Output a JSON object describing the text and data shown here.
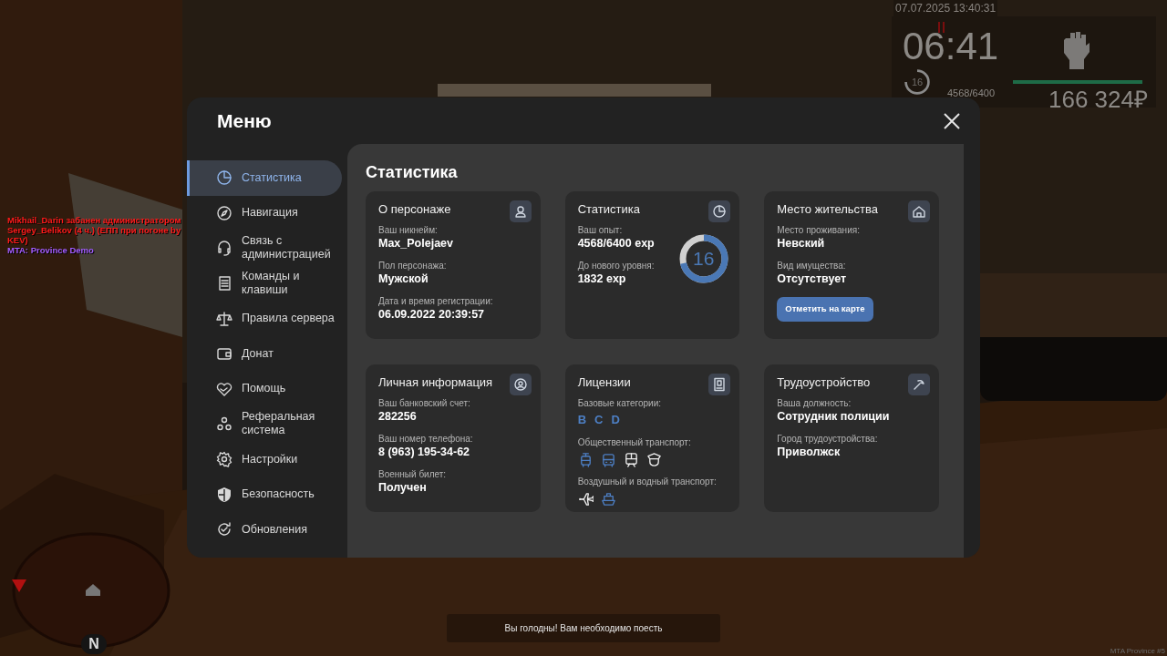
{
  "hud": {
    "datetime": "07.07.2025 13:40:31",
    "clock": "06:41",
    "level_number": "16",
    "exp": "4568/6400",
    "health": {
      "level": 1
    },
    "money": "166 324₽"
  },
  "chat": [
    {
      "text": "Mikhail_Darin забанен администратором Sergey_Belikov (4 ч.) (ЕПП при погоне by KEV)",
      "color": "#ff1a1a"
    },
    {
      "text": "MTA: Province Demo",
      "color": "#a25cff"
    }
  ],
  "minimap": {
    "compass": "N"
  },
  "menu": {
    "title": "Меню",
    "sidebar": [
      {
        "label": "Статистика",
        "selected": true
      },
      {
        "label": "Навигация",
        "selected": false
      },
      {
        "label": "Связь с администрацией",
        "selected": false
      },
      {
        "label": "Команды и клавиши",
        "selected": false
      },
      {
        "label": "Правила сервера",
        "selected": false
      },
      {
        "label": "Донат",
        "selected": false
      },
      {
        "label": "Помощь",
        "selected": false
      },
      {
        "label": "Реферальная система",
        "selected": false
      },
      {
        "label": "Настройки",
        "selected": false
      },
      {
        "label": "Безопасность",
        "selected": false
      },
      {
        "label": "Обновления",
        "selected": false
      }
    ],
    "page_title": "Статистика",
    "cards": [
      {
        "kind": "fields",
        "title": "О персонаже",
        "fields": [
          {
            "label": "Ваш никнейм:",
            "value": "Max_Polejaev"
          },
          {
            "label": "Пол персонажа:",
            "value": "Мужской"
          },
          {
            "label": "Дата и время регистрации:",
            "value": "06.09.2022 20:39:57"
          }
        ]
      },
      {
        "kind": "fields",
        "title": "Статистика",
        "fields": [
          {
            "label": "Ваш опыт:",
            "value": "4568/6400 exp"
          },
          {
            "label": "До нового уровня:",
            "value": "1832 exp"
          }
        ],
        "ring": {
          "value": "16",
          "level": 0.71
        }
      },
      {
        "kind": "fields",
        "title": "Место жительства",
        "fields": [
          {
            "label": "Место проживания:",
            "value": "Невский"
          },
          {
            "label": "Вид имущества:",
            "value": "Отсутствует"
          }
        ],
        "button": "Отметить на карте"
      },
      {
        "kind": "fields",
        "title": "Личная информация",
        "fields": [
          {
            "label": "Ваш банковский счет:",
            "value": "282256"
          },
          {
            "label": "Ваш номер телефона:",
            "value": "8 (963) 195-34-62"
          },
          {
            "label": "Военный билет:",
            "value": "Получен"
          }
        ]
      },
      {
        "kind": "licenses",
        "title": "Лицензии",
        "sections": [
          {
            "kind": "letters",
            "label": "Базовые категории:",
            "items": [
              {
                "text": "B",
                "held": true
              },
              {
                "text": "C",
                "held": true
              },
              {
                "text": "D",
                "held": true
              }
            ]
          },
          {
            "kind": "icons",
            "label": "Общественный транспорт:",
            "items": [
              {
                "held": true
              },
              {
                "held": true
              },
              {
                "held": false
              },
              {
                "held": false
              }
            ]
          },
          {
            "kind": "icons",
            "label": "Воздушный и водный транспорт:",
            "items": [
              {
                "held": false
              },
              {
                "held": true
              }
            ]
          }
        ]
      },
      {
        "kind": "fields",
        "title": "Трудоустройство",
        "fields": [
          {
            "label": "Ваша должность:",
            "value": "Сотрудник полиции"
          },
          {
            "label": "Город трудоустройства:",
            "value": "Приволжск"
          }
        ]
      }
    ]
  },
  "notification": "Вы голодны! Вам необходимо поесть",
  "footer": "MTA Province #5"
}
